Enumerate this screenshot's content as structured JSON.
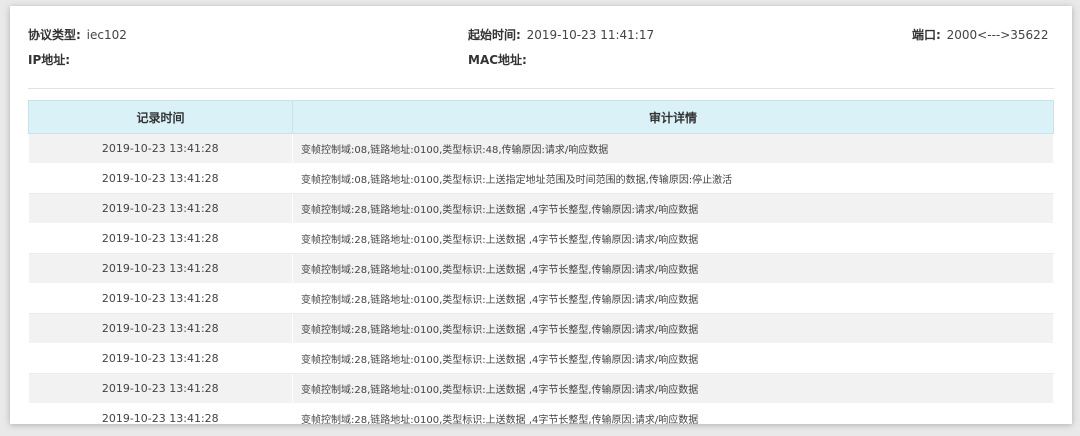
{
  "info": {
    "protocol_label": "协议类型:",
    "protocol_value": "iec102",
    "start_label": "起始时间:",
    "start_value": "2019-10-23 11:41:17",
    "port_label": "端口:",
    "port_value": "2000<--->35622",
    "ip_label": "IP地址:",
    "mac_label": "MAC地址:"
  },
  "table": {
    "columns": [
      "记录时间",
      "审计详情"
    ],
    "rows": [
      {
        "time": "2019-10-23 13:41:28",
        "detail": "变帧控制域:08,链路地址:0100,类型标识:48,传输原因:请求/响应数据"
      },
      {
        "time": "2019-10-23 13:41:28",
        "detail": "变帧控制域:08,链路地址:0100,类型标识:上送指定地址范围及时间范围的数据,传输原因:停止激活"
      },
      {
        "time": "2019-10-23 13:41:28",
        "detail": "变帧控制域:28,链路地址:0100,类型标识:上送数据 ,4字节长整型,传输原因:请求/响应数据"
      },
      {
        "time": "2019-10-23 13:41:28",
        "detail": "变帧控制域:28,链路地址:0100,类型标识:上送数据 ,4字节长整型,传输原因:请求/响应数据"
      },
      {
        "time": "2019-10-23 13:41:28",
        "detail": "变帧控制域:28,链路地址:0100,类型标识:上送数据 ,4字节长整型,传输原因:请求/响应数据"
      },
      {
        "time": "2019-10-23 13:41:28",
        "detail": "变帧控制域:28,链路地址:0100,类型标识:上送数据 ,4字节长整型,传输原因:请求/响应数据"
      },
      {
        "time": "2019-10-23 13:41:28",
        "detail": "变帧控制域:28,链路地址:0100,类型标识:上送数据 ,4字节长整型,传输原因:请求/响应数据"
      },
      {
        "time": "2019-10-23 13:41:28",
        "detail": "变帧控制域:28,链路地址:0100,类型标识:上送数据 ,4字节长整型,传输原因:请求/响应数据"
      },
      {
        "time": "2019-10-23 13:41:28",
        "detail": "变帧控制域:28,链路地址:0100,类型标识:上送数据 ,4字节长整型,传输原因:请求/响应数据"
      },
      {
        "time": "2019-10-23 13:41:28",
        "detail": "变帧控制域:28,链路地址:0100,类型标识:上送数据 ,4字节长整型,传输原因:请求/响应数据"
      }
    ]
  }
}
